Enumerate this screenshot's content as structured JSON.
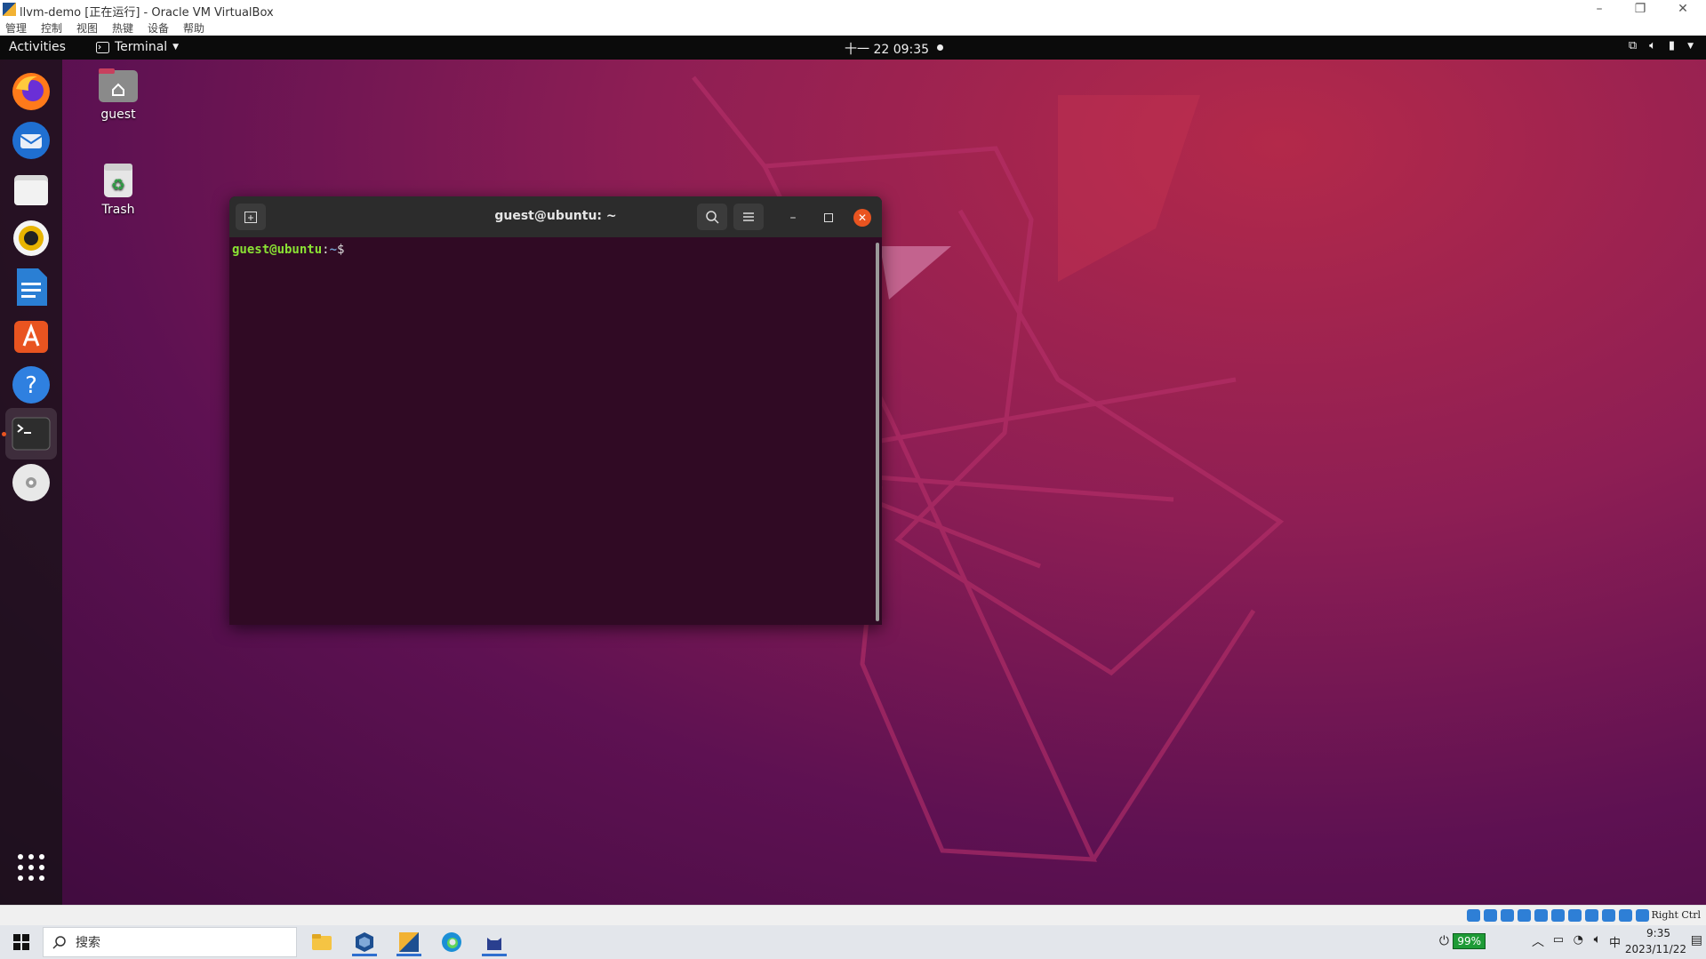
{
  "vbox": {
    "title": "llvm-demo [正在运行] - Oracle VM VirtualBox",
    "menu": [
      "管理",
      "控制",
      "视图",
      "热键",
      "设备",
      "帮助"
    ],
    "window_controls": [
      "–",
      "❐",
      "✕"
    ],
    "status_host_key": "Right Ctrl"
  },
  "topbar": {
    "activities": "Activities",
    "app_name": "Terminal",
    "clock": "十一 22  09:35"
  },
  "desktop": {
    "icons": [
      {
        "label": "guest",
        "icon": "home-folder-icon"
      },
      {
        "label": "Trash",
        "icon": "trash-icon"
      }
    ],
    "dock": [
      "firefox-icon",
      "thunderbird-icon",
      "files-icon",
      "rhythmbox-icon",
      "libreoffice-writer-icon",
      "app-center-icon",
      "help-icon",
      "terminal-icon",
      "dvd-icon",
      "show-apps-icon"
    ]
  },
  "terminal": {
    "title": "guest@ubuntu: ~",
    "prompt_user": "guest@ubuntu",
    "prompt_sep": ":",
    "prompt_path": "~",
    "prompt_symbol": "$"
  },
  "taskbar": {
    "search_placeholder": "搜索",
    "battery": "99%",
    "ime": "中",
    "time": "9:35",
    "date": "2023/11/22"
  }
}
